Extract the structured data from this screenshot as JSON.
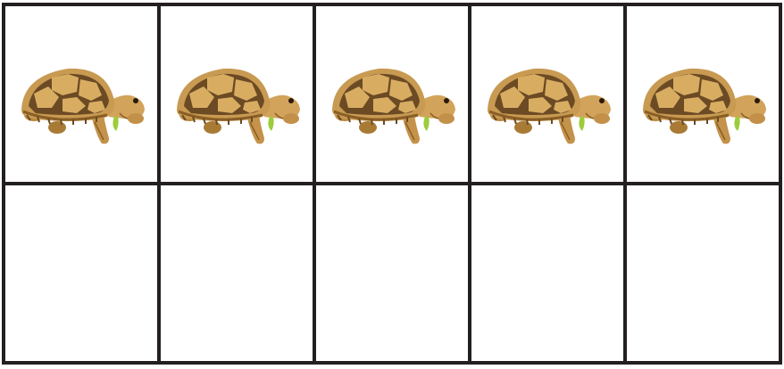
{
  "ten_frame": {
    "rows": 2,
    "columns": 5,
    "cells": [
      {
        "filled": true,
        "icon": "tortoise-icon"
      },
      {
        "filled": true,
        "icon": "tortoise-icon"
      },
      {
        "filled": true,
        "icon": "tortoise-icon"
      },
      {
        "filled": true,
        "icon": "tortoise-icon"
      },
      {
        "filled": true,
        "icon": "tortoise-icon"
      },
      {
        "filled": false,
        "icon": ""
      },
      {
        "filled": false,
        "icon": ""
      },
      {
        "filled": false,
        "icon": ""
      },
      {
        "filled": false,
        "icon": ""
      },
      {
        "filled": false,
        "icon": ""
      }
    ],
    "colors": {
      "border": "#231f20",
      "cell_background": "#ffffff"
    }
  }
}
